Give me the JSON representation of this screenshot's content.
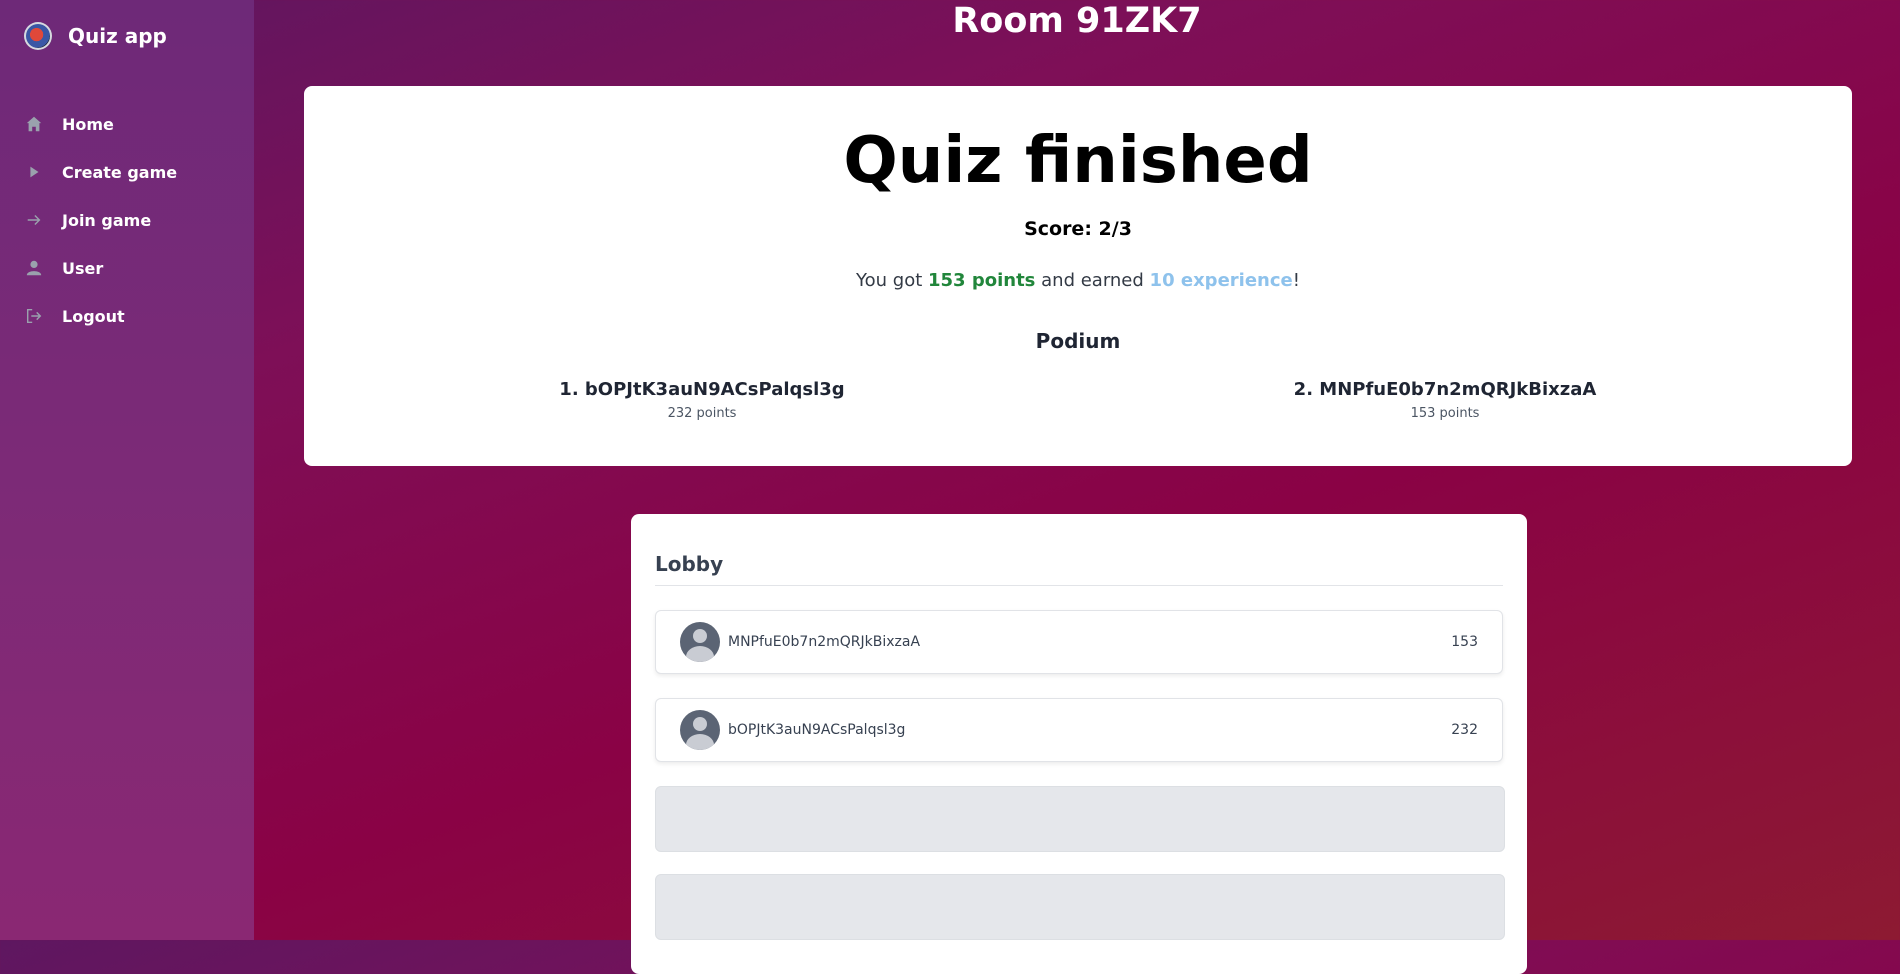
{
  "app": {
    "name": "Quiz app"
  },
  "sidebar": {
    "items": [
      {
        "label": "Home",
        "icon": "home-icon"
      },
      {
        "label": "Create game",
        "icon": "play-icon"
      },
      {
        "label": "Join game",
        "icon": "arrow-right-icon"
      },
      {
        "label": "User",
        "icon": "user-icon"
      },
      {
        "label": "Logout",
        "icon": "logout-icon"
      }
    ]
  },
  "room": {
    "title": "Room 91ZK7"
  },
  "result": {
    "title": "Quiz finished",
    "score": "Score: 2/3",
    "summary_prefix": "You got ",
    "points_text": "153 points",
    "summary_middle": " and earned ",
    "experience_text": "10 experience",
    "summary_suffix": "!",
    "podium_title": "Podium",
    "podium": [
      {
        "name": "1. bOPJtK3auN9ACsPalqsl3g",
        "points": "232 points"
      },
      {
        "name": "2. MNPfuE0b7n2mQRJkBixzaA",
        "points": "153 points"
      }
    ]
  },
  "lobby": {
    "title": "Lobby",
    "players": [
      {
        "name": "MNPfuE0b7n2mQRJkBixzaA",
        "score": "153"
      },
      {
        "name": "bOPJtK3auN9ACsPalqsl3g",
        "score": "232"
      }
    ],
    "empty_slots": 2
  },
  "colors": {
    "points": "#21863b",
    "experience": "#8ec2ec"
  }
}
